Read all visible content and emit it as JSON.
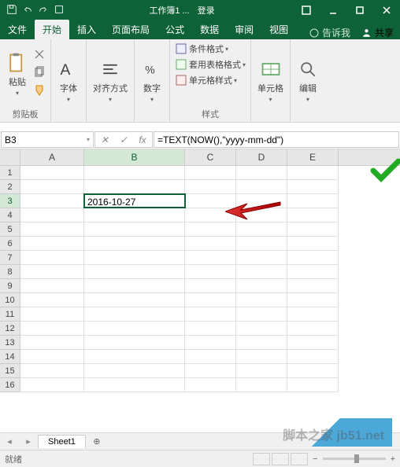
{
  "titlebar": {
    "doc": "工作簿1 ...",
    "login": "登录"
  },
  "tabs": {
    "file": "文件",
    "home": "开始",
    "insert": "插入",
    "layout": "页面布局",
    "formulas": "公式",
    "data": "数据",
    "review": "审阅",
    "view": "视图",
    "tellme": "告诉我",
    "share": "共享"
  },
  "ribbon": {
    "clipboard": {
      "paste": "粘贴",
      "label": "剪贴板"
    },
    "font": {
      "label": "字体"
    },
    "align": {
      "label": "对齐方式"
    },
    "number": {
      "label": "数字"
    },
    "styles": {
      "cond": "条件格式",
      "table": "套用表格格式",
      "cell": "单元格样式",
      "label": "样式"
    },
    "cells": {
      "label": "单元格"
    },
    "editing": {
      "label": "编辑"
    }
  },
  "formula": {
    "cellref": "B3",
    "content": "=TEXT(NOW(),\"yyyy-mm-dd\")"
  },
  "cell_value": "2016-10-27",
  "columns": [
    "A",
    "B",
    "C",
    "D",
    "E"
  ],
  "rows": [
    "1",
    "2",
    "3",
    "4",
    "5",
    "6",
    "7",
    "8",
    "9",
    "10",
    "11",
    "12",
    "13",
    "14",
    "15",
    "16"
  ],
  "sheet": {
    "name": "Sheet1"
  },
  "status": {
    "ready": "就绪",
    "zoom": "+"
  },
  "watermark": "脚本之家 jb51.net"
}
